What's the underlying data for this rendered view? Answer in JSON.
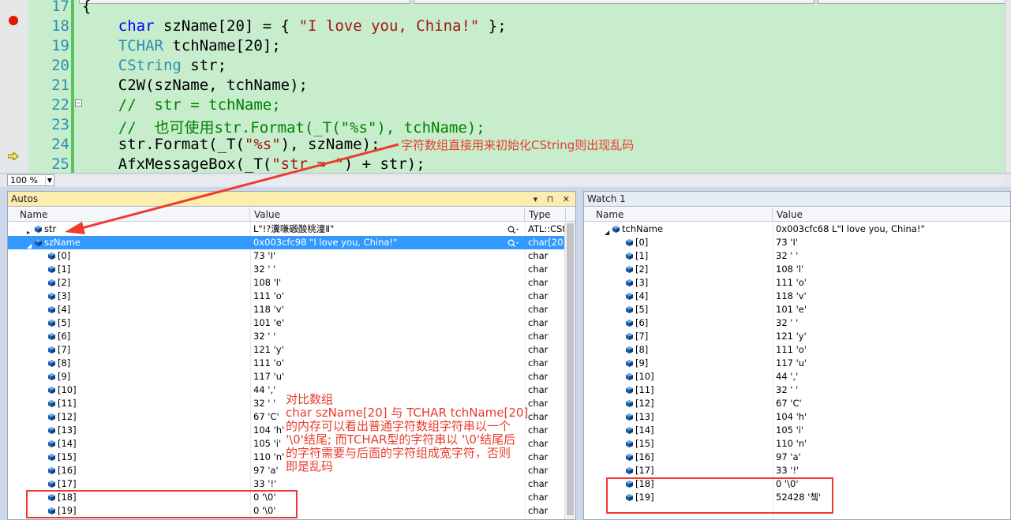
{
  "editor": {
    "line_numbers": [
      "17",
      "18",
      "19",
      "20",
      "21",
      "22",
      "23",
      "24",
      "25"
    ],
    "code": [
      {
        "parts": [
          {
            "t": "{",
            "c": ""
          }
        ]
      },
      {
        "parts": [
          {
            "t": "    ",
            "c": ""
          },
          {
            "t": "char",
            "c": "kw"
          },
          {
            "t": " szName[20] = { ",
            "c": ""
          },
          {
            "t": "\"I love you, China!\"",
            "c": "st"
          },
          {
            "t": " };",
            "c": ""
          }
        ]
      },
      {
        "parts": [
          {
            "t": "    ",
            "c": ""
          },
          {
            "t": "TCHAR",
            "c": "ty"
          },
          {
            "t": " tchName[20];",
            "c": ""
          }
        ]
      },
      {
        "parts": [
          {
            "t": "    ",
            "c": ""
          },
          {
            "t": "CString",
            "c": "ty"
          },
          {
            "t": " str;",
            "c": ""
          }
        ]
      },
      {
        "parts": [
          {
            "t": "    C2W(szName, tchName);",
            "c": ""
          }
        ]
      },
      {
        "parts": [
          {
            "t": "    ",
            "c": ""
          },
          {
            "t": "//  str = tchName;",
            "c": "cm"
          }
        ]
      },
      {
        "parts": [
          {
            "t": "    ",
            "c": ""
          },
          {
            "t": "//  也可使用str.Format(_T(\"%s\"), tchName);",
            "c": "cm"
          }
        ]
      },
      {
        "parts": [
          {
            "t": "    str.Format(_T(",
            "c": ""
          },
          {
            "t": "\"%s\"",
            "c": "st"
          },
          {
            "t": "), szName);",
            "c": ""
          }
        ]
      },
      {
        "parts": [
          {
            "t": "    AfxMessageBox(_T(",
            "c": ""
          },
          {
            "t": "\"str = \"",
            "c": "st"
          },
          {
            "t": ") + str);",
            "c": ""
          }
        ]
      }
    ],
    "annotation": "字符数组直接用来初始化CString则出现乱码",
    "zoom": "100 %"
  },
  "autos": {
    "title": "Autos",
    "title_buttons": "▾ ⊓ ✕",
    "columns": [
      "Name",
      "Value",
      "Type"
    ],
    "rows": [
      {
        "name": "str",
        "value": "L\"!?瀵嗛磤酸桃潼Ⅱ\"",
        "type": "ATL::CSt",
        "level": 0,
        "expand": "▸",
        "icon": "pin",
        "mag": true
      },
      {
        "name": "szName",
        "value": "0x003cfc98 \"I love you, China!\"",
        "type": "char[20]",
        "level": 0,
        "expand": "◢",
        "icon": "pin",
        "mag": true,
        "sel": true
      },
      {
        "name": "[0]",
        "value": "73 'I'",
        "type": "char",
        "level": 1
      },
      {
        "name": "[1]",
        "value": "32 ' '",
        "type": "char",
        "level": 1
      },
      {
        "name": "[2]",
        "value": "108 'l'",
        "type": "char",
        "level": 1
      },
      {
        "name": "[3]",
        "value": "111 'o'",
        "type": "char",
        "level": 1
      },
      {
        "name": "[4]",
        "value": "118 'v'",
        "type": "char",
        "level": 1
      },
      {
        "name": "[5]",
        "value": "101 'e'",
        "type": "char",
        "level": 1
      },
      {
        "name": "[6]",
        "value": "32 ' '",
        "type": "char",
        "level": 1
      },
      {
        "name": "[7]",
        "value": "121 'y'",
        "type": "char",
        "level": 1
      },
      {
        "name": "[8]",
        "value": "111 'o'",
        "type": "char",
        "level": 1
      },
      {
        "name": "[9]",
        "value": "117 'u'",
        "type": "char",
        "level": 1
      },
      {
        "name": "[10]",
        "value": "44 ','",
        "type": "char",
        "level": 1
      },
      {
        "name": "[11]",
        "value": "32 ' '",
        "type": "char",
        "level": 1
      },
      {
        "name": "[12]",
        "value": "67 'C'",
        "type": "char",
        "level": 1
      },
      {
        "name": "[13]",
        "value": "104 'h'",
        "type": "char",
        "level": 1
      },
      {
        "name": "[14]",
        "value": "105 'i'",
        "type": "char",
        "level": 1
      },
      {
        "name": "[15]",
        "value": "110 'n'",
        "type": "char",
        "level": 1
      },
      {
        "name": "[16]",
        "value": "97 'a'",
        "type": "char",
        "level": 1
      },
      {
        "name": "[17]",
        "value": "33 '!'",
        "type": "char",
        "level": 1
      },
      {
        "name": "[18]",
        "value": "0 '\\0'",
        "type": "char",
        "level": 1
      },
      {
        "name": "[19]",
        "value": "0 '\\0'",
        "type": "char",
        "level": 1
      }
    ],
    "annotation_lines": [
      "对比数组",
      "char szName[20] 与 TCHAR tchName[20]",
      "的内存可以看出普通字符数组字符串以一个",
      "'\\0'结尾; 而TCHAR型的字符串以 '\\0'结尾后",
      "的字符需要与后面的字符组成宽字符，否则",
      "即是乱码"
    ]
  },
  "watch": {
    "title": "Watch 1",
    "columns": [
      "Name",
      "Value"
    ],
    "rows": [
      {
        "name": "tchName",
        "value": "0x003cfc68 L\"I love you, China!\"",
        "level": 0,
        "expand": "◢"
      },
      {
        "name": "[0]",
        "value": "73 'I'",
        "level": 1
      },
      {
        "name": "[1]",
        "value": "32 ' '",
        "level": 1
      },
      {
        "name": "[2]",
        "value": "108 'l'",
        "level": 1
      },
      {
        "name": "[3]",
        "value": "111 'o'",
        "level": 1
      },
      {
        "name": "[4]",
        "value": "118 'v'",
        "level": 1
      },
      {
        "name": "[5]",
        "value": "101 'e'",
        "level": 1
      },
      {
        "name": "[6]",
        "value": "32 ' '",
        "level": 1
      },
      {
        "name": "[7]",
        "value": "121 'y'",
        "level": 1
      },
      {
        "name": "[8]",
        "value": "111 'o'",
        "level": 1
      },
      {
        "name": "[9]",
        "value": "117 'u'",
        "level": 1
      },
      {
        "name": "[10]",
        "value": "44 ','",
        "level": 1
      },
      {
        "name": "[11]",
        "value": "32 ' '",
        "level": 1
      },
      {
        "name": "[12]",
        "value": "67 'C'",
        "level": 1
      },
      {
        "name": "[13]",
        "value": "104 'h'",
        "level": 1
      },
      {
        "name": "[14]",
        "value": "105 'i'",
        "level": 1
      },
      {
        "name": "[15]",
        "value": "110 'n'",
        "level": 1
      },
      {
        "name": "[16]",
        "value": "97 'a'",
        "level": 1
      },
      {
        "name": "[17]",
        "value": "33 '!'",
        "level": 1
      },
      {
        "name": "[18]",
        "value": "0 '\\0'",
        "level": 1
      },
      {
        "name": "[19]",
        "value": "52428 '쳌'",
        "level": 1
      }
    ]
  },
  "colors": {
    "editor_bg": "#c7edcc",
    "selection": "#3399ff",
    "annotation": "#e83b2b",
    "breakpoint": "#e51400"
  }
}
